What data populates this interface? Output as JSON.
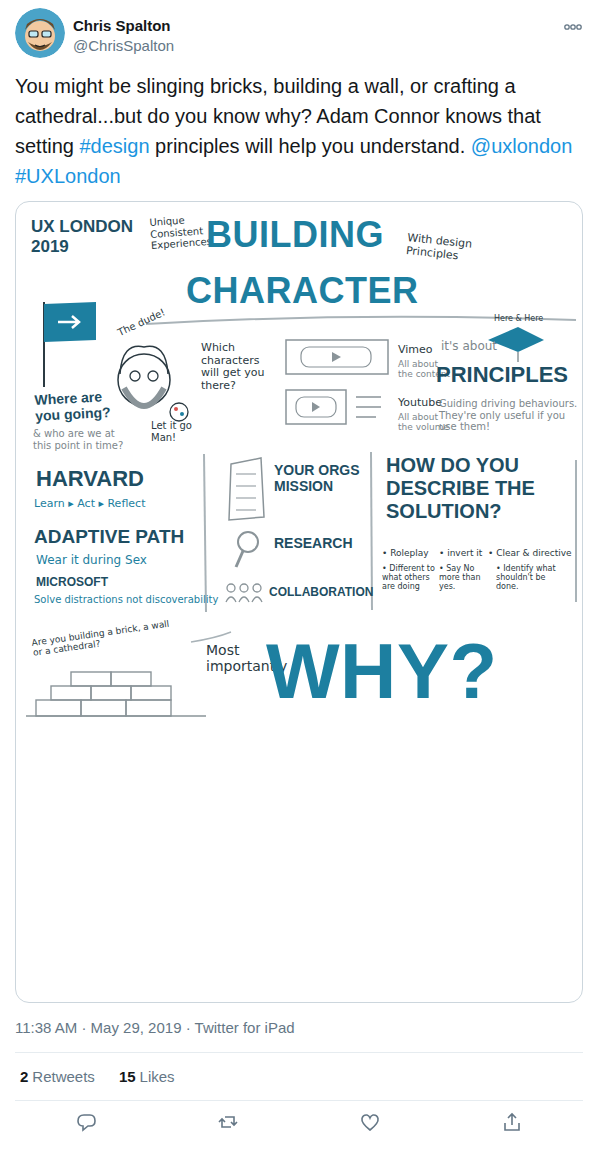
{
  "tweet": {
    "author": {
      "name": "Chris Spalton",
      "handle": "@ChrisSpalton"
    },
    "body": [
      {
        "text": "You might be slinging bricks, building a wall, or crafting a cathedral...but do you know why? Adam Connor knows that setting ",
        "kind": "plain"
      },
      {
        "text": "#design",
        "kind": "link"
      },
      {
        "text": " principles will help you understand. ",
        "kind": "plain"
      },
      {
        "text": "@uxlondon",
        "kind": "link"
      },
      {
        "text": " ",
        "kind": "plain"
      },
      {
        "text": "#UXLondon",
        "kind": "link"
      }
    ],
    "meta": "11:38 AM · May 29, 2019 · Twitter for iPad",
    "stats": [
      {
        "count": "2",
        "label": "Retweets"
      },
      {
        "count": "15",
        "label": "Likes"
      }
    ],
    "actions": [
      {
        "kind": "reply"
      },
      {
        "kind": "retweet"
      },
      {
        "kind": "like"
      },
      {
        "kind": "share"
      }
    ]
  },
  "sketchnote": {
    "items": [
      {
        "text": "UX LONDON 2019",
        "kind": "heading"
      },
      {
        "text": "Unique Consistent Experiences",
        "kind": "note"
      },
      {
        "text": "BUILDING",
        "kind": "title"
      },
      {
        "text": "CHARACTER",
        "kind": "title"
      },
      {
        "text": "With design Principles",
        "kind": "note"
      },
      {
        "text": "The dude!",
        "kind": "note"
      },
      {
        "text": "Which characters will get you there?",
        "kind": "note"
      },
      {
        "text": "Vimeo",
        "kind": "note"
      },
      {
        "text": "All about the content",
        "kind": "muted"
      },
      {
        "text": "Youtube",
        "kind": "note"
      },
      {
        "text": "All about the volume",
        "kind": "muted"
      },
      {
        "text": "it's about",
        "kind": "muted"
      },
      {
        "text": "Here & Here",
        "kind": "note"
      },
      {
        "text": "PRINCIPLES",
        "kind": "heading"
      },
      {
        "text": "Guiding driving behaviours. They're only useful if you use them!",
        "kind": "muted"
      },
      {
        "text": "Where are you going?",
        "kind": "heading"
      },
      {
        "text": "& who are we at this point in time?",
        "kind": "muted"
      },
      {
        "text": "Let it go Man!",
        "kind": "note"
      },
      {
        "text": "HARVARD",
        "kind": "heading"
      },
      {
        "text": "Learn ▸ Act ▸ Reflect",
        "kind": "accent"
      },
      {
        "text": "ADAPTIVE PATH",
        "kind": "heading"
      },
      {
        "text": "Wear it during Sex",
        "kind": "accent"
      },
      {
        "text": "MICROSOFT",
        "kind": "heading"
      },
      {
        "text": "Solve distractions not discoverability",
        "kind": "accent"
      },
      {
        "text": "YOUR ORGS MISSION",
        "kind": "heading"
      },
      {
        "text": "RESEARCH",
        "kind": "heading"
      },
      {
        "text": "COLLABORATION",
        "kind": "heading"
      },
      {
        "text": "HOW DO YOU DESCRIBE THE SOLUTION?",
        "kind": "heading"
      },
      {
        "text": "• Roleplay",
        "kind": "note"
      },
      {
        "text": "• invert it",
        "kind": "note"
      },
      {
        "text": "• Clear & directive",
        "kind": "note"
      },
      {
        "text": "• Different to what others are doing",
        "kind": "note"
      },
      {
        "text": "• Say No more than yes.",
        "kind": "note"
      },
      {
        "text": "• Identify what shouldn't be done.",
        "kind": "note"
      },
      {
        "text": "Are you building a brick, a wall or a cathedral?",
        "kind": "note"
      },
      {
        "text": "Most importantly",
        "kind": "note"
      },
      {
        "text": "WHY?",
        "kind": "title"
      }
    ]
  }
}
